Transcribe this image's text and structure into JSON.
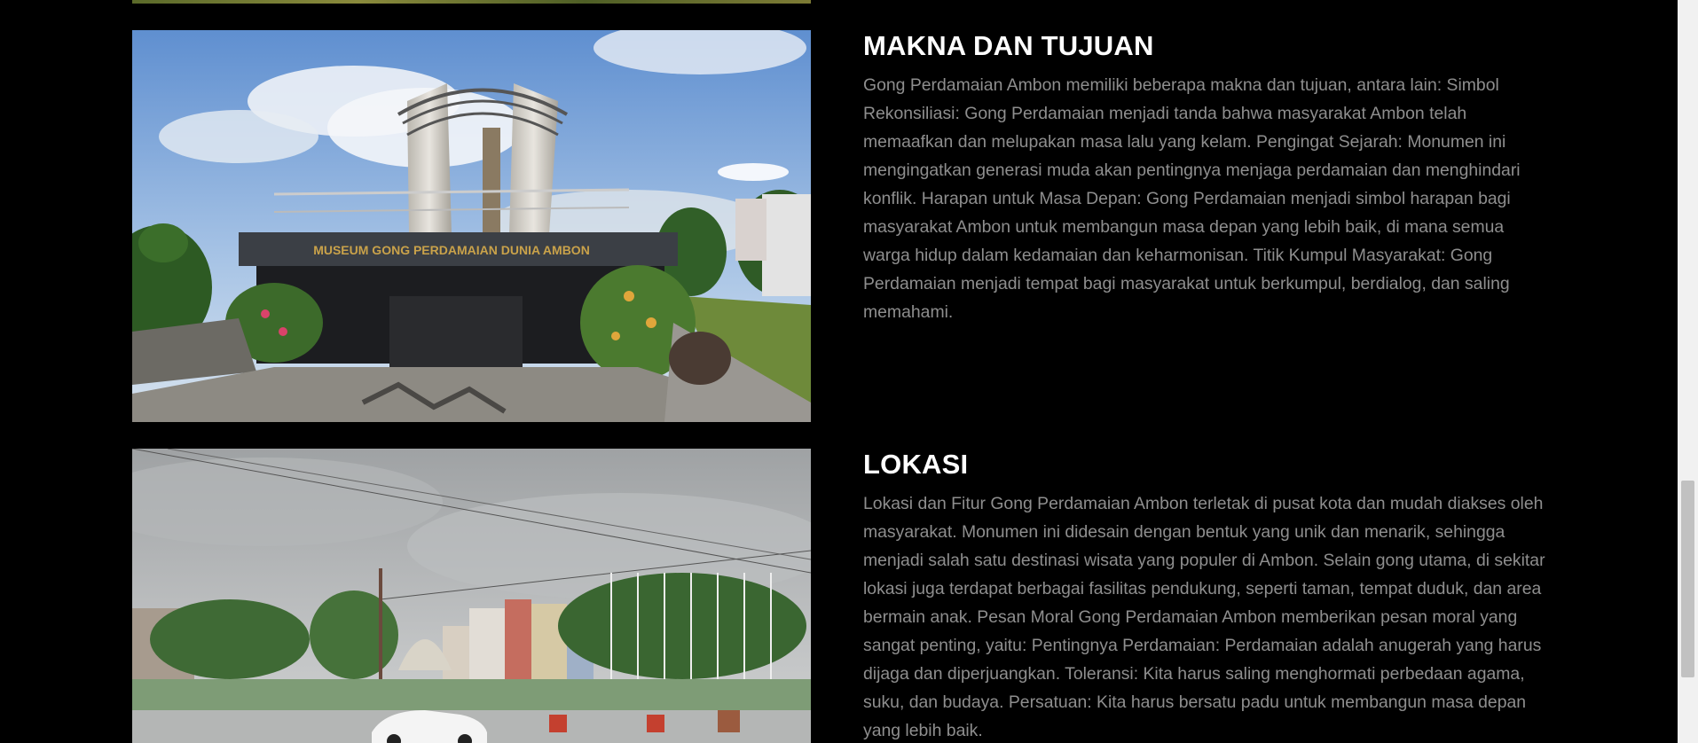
{
  "sections": [
    {
      "heading": "MAKNA DAN TUJUAN",
      "body": "Gong Perdamaian Ambon memiliki beberapa makna dan tujuan, antara lain: Simbol Rekonsiliasi: Gong Perdamaian menjadi tanda bahwa masyarakat Ambon telah memaafkan dan melupakan masa lalu yang kelam. Pengingat Sejarah: Monumen ini mengingatkan generasi muda akan pentingnya menjaga perdamaian dan menghindari konflik. Harapan untuk Masa Depan: Gong Perdamaian menjadi simbol harapan bagi masyarakat Ambon untuk membangun masa depan yang lebih baik, di mana semua warga hidup dalam kedamaian dan keharmonisan. Titik Kumpul Masyarakat: Gong Perdamaian menjadi tempat bagi masyarakat untuk berkumpul, berdialog, dan saling memahami.",
      "image_sign_text": "MUSEUM GONG PERDAMAIAN DUNIA AMBON"
    },
    {
      "heading": "LOKASI",
      "body": "Lokasi dan Fitur Gong Perdamaian Ambon terletak di pusat kota dan mudah diakses oleh masyarakat. Monumen ini didesain dengan bentuk yang unik dan menarik, sehingga menjadi salah satu destinasi wisata yang populer di Ambon. Selain gong utama, di sekitar lokasi juga terdapat berbagai fasilitas pendukung, seperti taman, tempat duduk, dan area bermain anak. Pesan Moral Gong Perdamaian Ambon memberikan pesan moral yang sangat penting, yaitu: Pentingnya Perdamaian: Perdamaian adalah anugerah yang harus dijaga dan diperjuangkan. Toleransi: Kita harus saling menghormati perbedaan agama, suku, dan budaya. Persatuan: Kita harus bersatu padu untuk membangun masa depan yang lebih baik."
    }
  ],
  "colors": {
    "background": "#000000",
    "heading": "#ffffff",
    "body_text": "#8e8e8e"
  }
}
